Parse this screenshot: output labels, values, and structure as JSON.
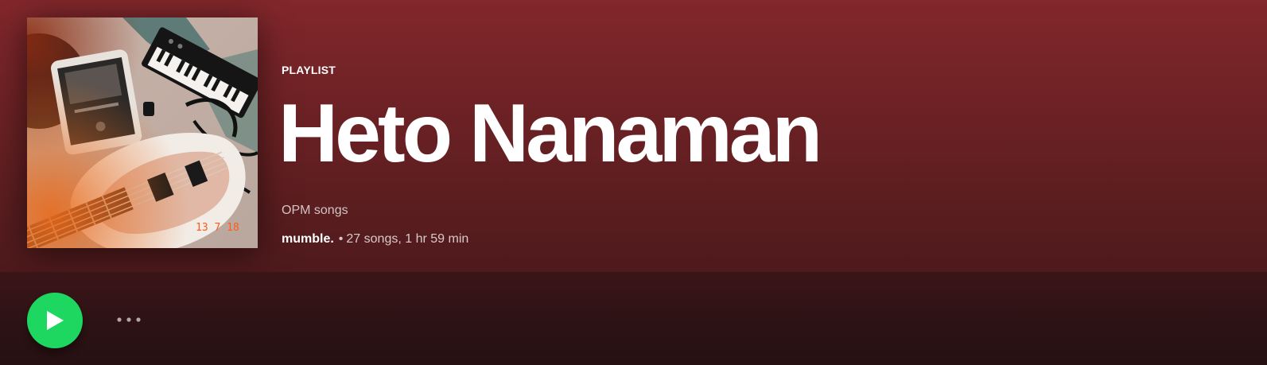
{
  "theme": {
    "accent": "#1ed760",
    "header_color": "#82272b",
    "background_color": "#2a1214"
  },
  "playlist": {
    "type_label": "PLAYLIST",
    "title": "Heto Nanaman",
    "description": "OPM songs",
    "owner": "mumble.",
    "separator": "•",
    "stats": "27 songs, 1 hr 59 min",
    "cover_overlay_text": "13 7 18"
  },
  "actions": {
    "play_icon": "play-icon",
    "more_icon": "more-options-icon"
  }
}
